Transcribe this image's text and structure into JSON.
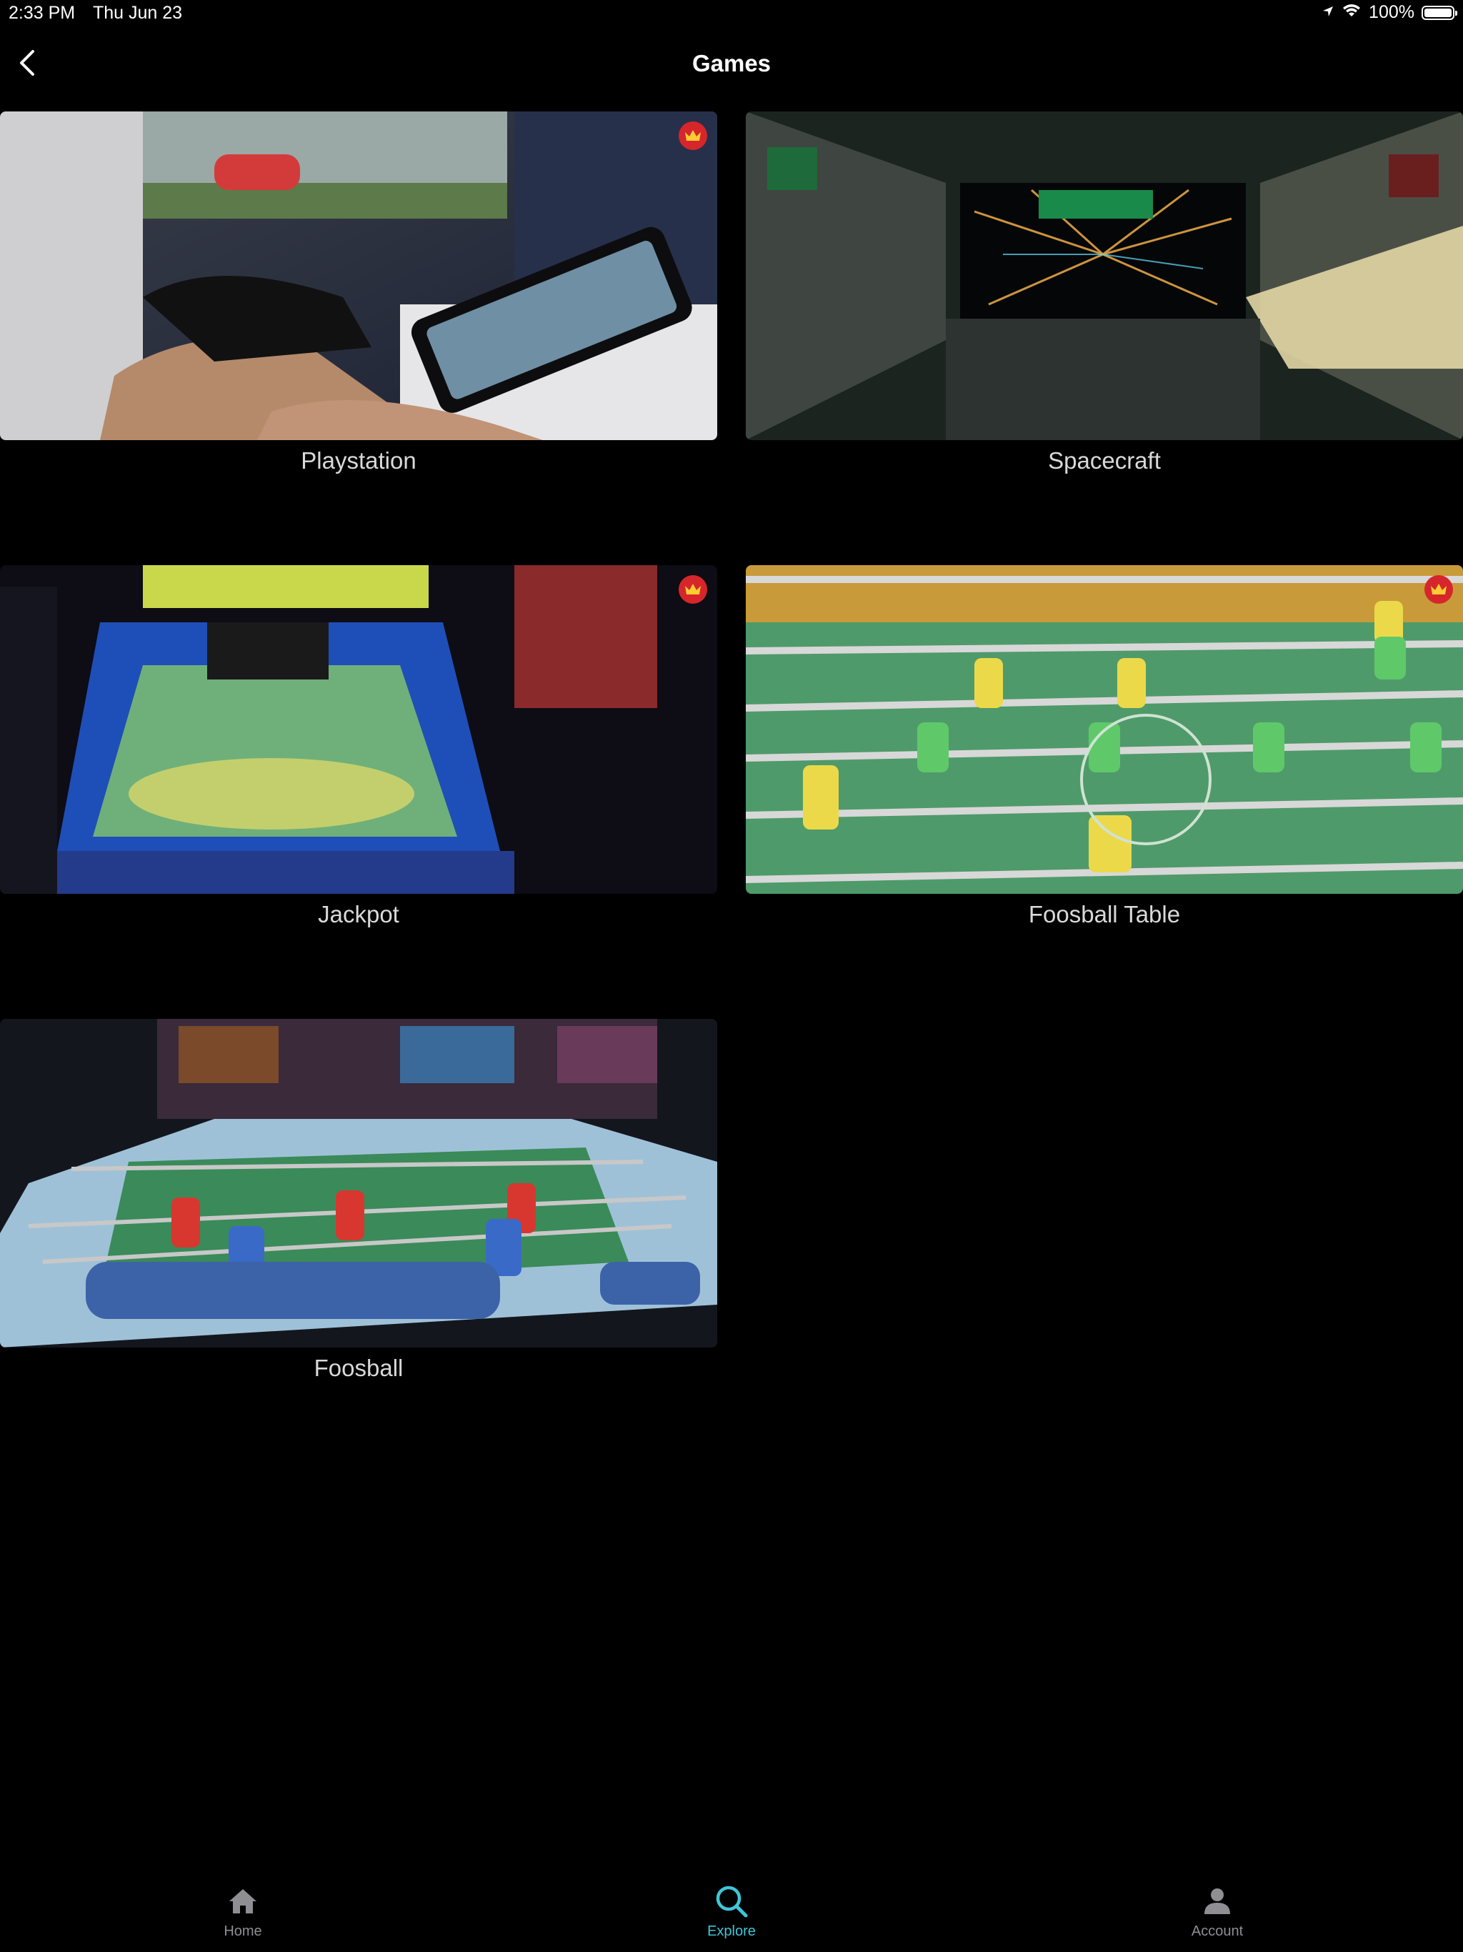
{
  "status_bar": {
    "time": "2:33 PM",
    "date": "Thu Jun 23",
    "battery": "100%"
  },
  "header": {
    "title": "Games",
    "back_icon": "chevron-left-icon"
  },
  "games": [
    {
      "label": "Playstation",
      "premium": true
    },
    {
      "label": "Spacecraft",
      "premium": false
    },
    {
      "label": "Jackpot",
      "premium": true
    },
    {
      "label": "Foosball Table",
      "premium": true
    },
    {
      "label": "Foosball",
      "premium": false
    }
  ],
  "tab_bar": {
    "items": [
      {
        "label": "Home",
        "icon": "home-icon",
        "active": false
      },
      {
        "label": "Explore",
        "icon": "search-icon",
        "active": true
      },
      {
        "label": "Account",
        "icon": "person-icon",
        "active": false
      }
    ]
  },
  "colors": {
    "accent": "#3ec6d8",
    "premium_badge": "#d6262b",
    "background": "#000000"
  }
}
